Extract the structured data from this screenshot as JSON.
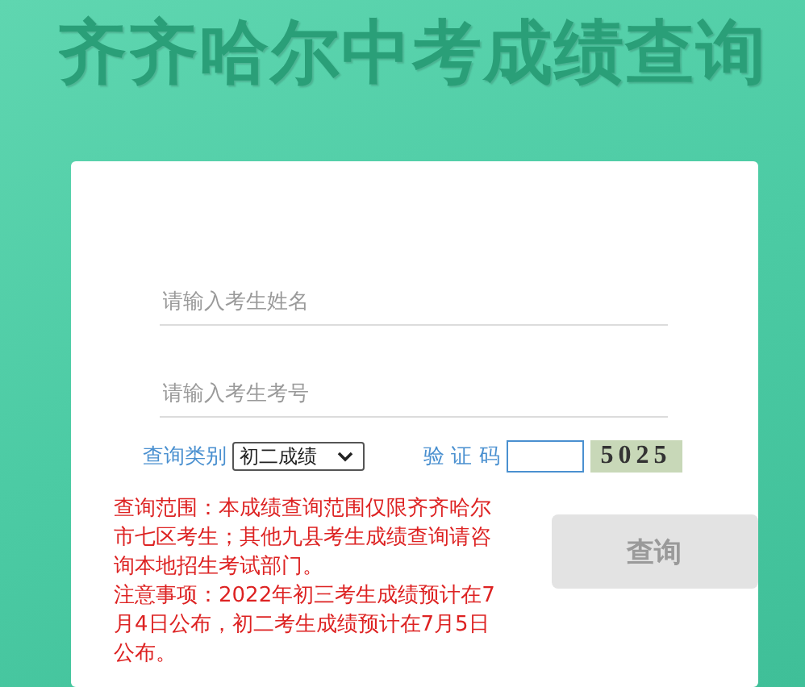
{
  "title": "齐齐哈尔中考成绩查询",
  "form": {
    "name_field": {
      "placeholder": "请输入考生姓名"
    },
    "number_field": {
      "placeholder": "请输入考生考号"
    },
    "category": {
      "label": "查询类别",
      "value": "初二成绩"
    },
    "captcha": {
      "label": "验 证 码",
      "code": "5025"
    },
    "notes": [
      "查询范围：本成绩查询范围仅限齐齐哈尔市七区考生；其他九县考生成绩查询请咨询本地招生考试部门。",
      "注意事项：2022年初三考生成绩预计在7月4日公布，初二考生成绩预计在7月5日公布。"
    ],
    "submit": {
      "label": "查询",
      "disabled": true
    }
  }
}
